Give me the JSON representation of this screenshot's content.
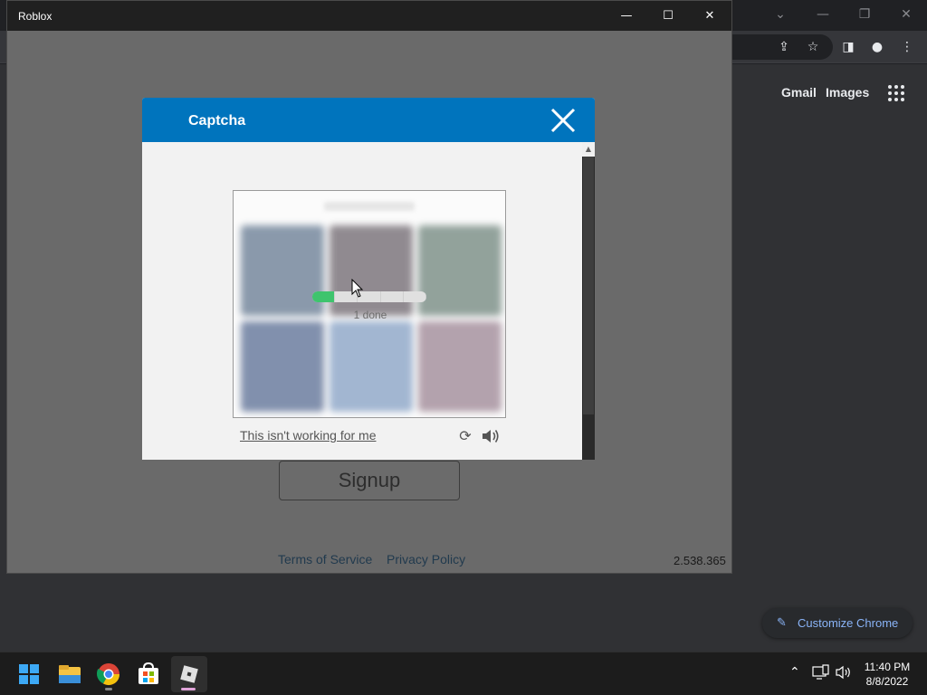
{
  "chrome": {
    "gmail_label": "Gmail",
    "images_label": "Images",
    "customize_label": "Customize Chrome"
  },
  "roblox": {
    "window_title": "Roblox",
    "signup_label": "Signup",
    "terms_label": "Terms of Service",
    "privacy_label": "Privacy Policy",
    "version": "2.538.365"
  },
  "captcha": {
    "title": "Captcha",
    "progress_text": "1 done",
    "progress_done": 1,
    "progress_total": 5,
    "not_working_label": "This isn't working for me"
  },
  "taskbar": {
    "time": "11:40 PM",
    "date": "8/8/2022",
    "apps": [
      "windows-start",
      "file-explorer",
      "chrome",
      "microsoft-store",
      "roblox"
    ]
  },
  "colors": {
    "captcha_header": "#0074bd",
    "progress_done": "#3ec46d",
    "chrome_link": "#8ab4f8"
  }
}
